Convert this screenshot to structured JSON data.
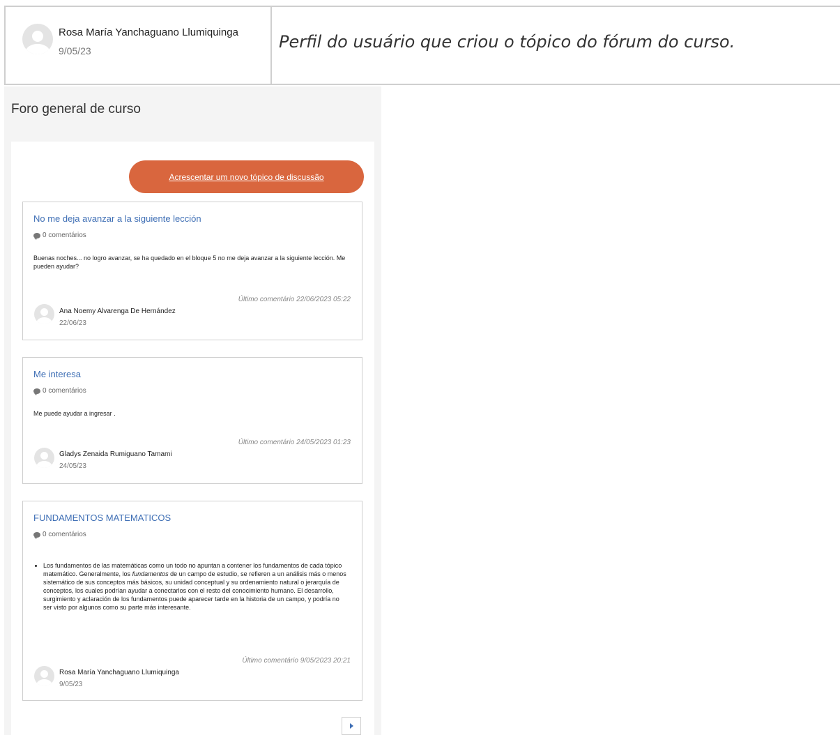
{
  "header_table": {
    "user_name": "Rosa María Yanchaguano Llumiquinga",
    "user_date": "9/05/23",
    "caption": "Perfil do usuário que criou o tópico do fórum do curso."
  },
  "forum": {
    "title": "Foro general de curso",
    "add_topic_label": "Acrescentar um novo tópico de discussão",
    "posts": [
      {
        "title": "No me deja avanzar a la siguiente lección",
        "comments": "0 comentários",
        "body": "Buenas noches... no logro avanzar, se ha quedado en el bloque 5 no me deja avanzar a la siguiente lección. Me pueden ayudar?",
        "last_comment": "Último comentário 22/06/2023 05:22",
        "author": "Ana Noemy Alvarenga De Hernández",
        "date": "22/06/23"
      },
      {
        "title": "Me interesa",
        "comments": "0 comentários",
        "body": "Me puede ayudar a ingresar .",
        "last_comment": "Último comentário 24/05/2023 01:23",
        "author": "Gladys Zenaida Rumiguano Tamami",
        "date": "24/05/23"
      },
      {
        "title": "FUNDAMENTOS MATEMATICOS",
        "comments": "0 comentários",
        "body_pre": "Los fundamentos de las matemáticas como un todo no apuntan a contener los fundamentos de cada tópico matemático. Generalmente, los ",
        "body_em": "fundamentos",
        "body_post": " de un campo de estudio, se refieren a un análisis más o menos sistemático de sus conceptos más básicos, su unidad conceptual y su ordenamiento natural o jerarquía de conceptos, los cuales podrían ayudar a conectarlos con el resto del conocimiento humano. El desarrollo, surgimiento y aclaración de los fundamentos puede aparecer tarde en la historia de un campo, y podría no ser visto por algunos como su parte más interesante.",
        "last_comment": "Último comentário 9/05/2023 20:21",
        "author": "Rosa María Yanchaguano Llumiquinga",
        "date": "9/05/23"
      }
    ]
  },
  "colors": {
    "accent": "#d9663e",
    "link": "#3f6fb5"
  }
}
